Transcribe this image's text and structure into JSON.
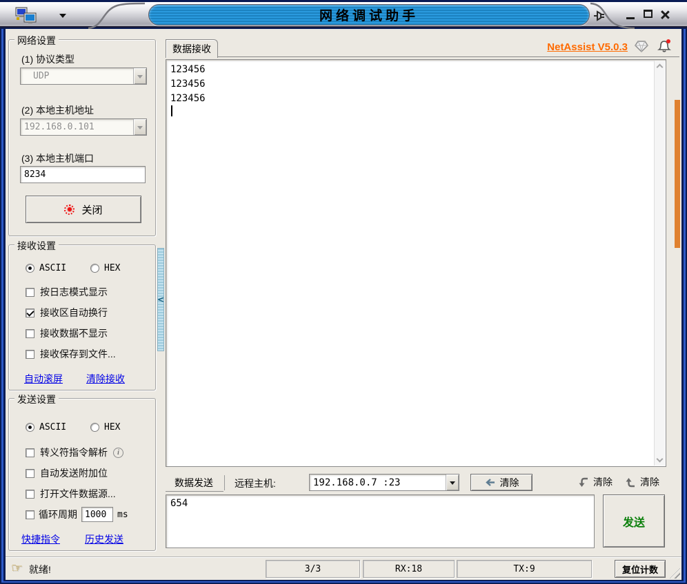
{
  "titlebar": {
    "title": "网络调试助手",
    "icons": {
      "app": "network-computers-icon",
      "menu_arrow": "dropdown-arrow-icon",
      "pin": "pin-icon",
      "minimize": "minimize-icon",
      "maximize": "maximize-icon",
      "close": "close-icon"
    }
  },
  "colors": {
    "frame_navy": "#0a1c55",
    "accent_blue": "#2e5ac8",
    "title_blue": "#2193d1",
    "link_blue": "#0000e6",
    "brand_orange": "#ff6a00",
    "send_green": "#0a7f0a",
    "led_red": "#ee1111",
    "right_thumb_orange": "#e0812f"
  },
  "sidebar": {
    "network": {
      "legend": "网络设置",
      "protocol_label": "(1) 协议类型",
      "protocol_value": "UDP",
      "address_label": "(2) 本地主机地址",
      "address_value": "192.168.0.101",
      "port_label": "(3) 本地主机端口",
      "port_value": "8234",
      "close_button": "关闭"
    },
    "receive": {
      "legend": "接收设置",
      "radio_ascii": "ASCII",
      "radio_hex": "HEX",
      "ascii_selected": true,
      "checkboxes": [
        {
          "label": "按日志模式显示",
          "checked": false
        },
        {
          "label": "接收区自动换行",
          "checked": true
        },
        {
          "label": "接收数据不显示",
          "checked": false
        },
        {
          "label": "接收保存到文件...",
          "checked": false
        }
      ],
      "link_autoscroll": "自动滚屏",
      "link_clear": "清除接收"
    },
    "send": {
      "legend": "发送设置",
      "radio_ascii": "ASCII",
      "radio_hex": "HEX",
      "ascii_selected": true,
      "checkboxes": [
        {
          "label": "转义符指令解析",
          "checked": false
        },
        {
          "label": "自动发送附加位",
          "checked": false
        },
        {
          "label": "打开文件数据源...",
          "checked": false
        },
        {
          "label": "循环周期",
          "checked": false
        }
      ],
      "cycle_value": "1000",
      "cycle_unit": "ms",
      "link_shortcut": "快捷指令",
      "link_history": "历史发送"
    }
  },
  "main": {
    "receive_tab": "数据接收",
    "version_link": "NetAssist V5.0.3",
    "icons": {
      "gem": "gem-icon",
      "bell": "bell-notification-icon"
    },
    "receive_lines": [
      "123456",
      "123456",
      "123456"
    ]
  },
  "sendbar": {
    "tab": "数据发送",
    "remote_label": "远程主机:",
    "remote_value": "192.168.0.7 :23",
    "clear_button": "清除",
    "clear_down_label": "清除",
    "clear_up_label": "清除"
  },
  "sendarea": {
    "value": "654",
    "send_button": "发送"
  },
  "statusbar": {
    "ready": "就绪!",
    "frames": "3/3",
    "rx": "RX:18",
    "tx": "TX:9",
    "reset_button": "复位计数"
  }
}
